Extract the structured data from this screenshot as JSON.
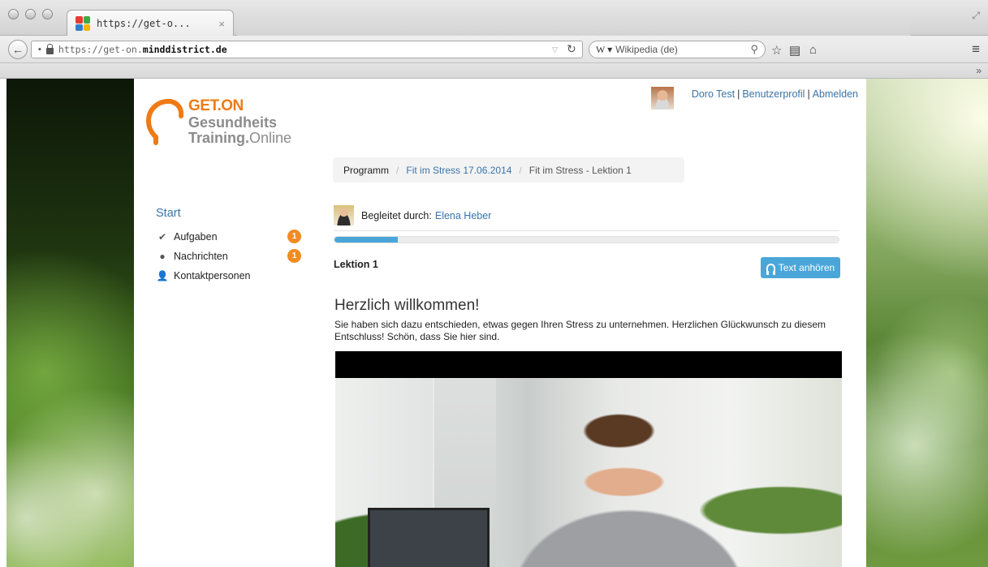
{
  "browser": {
    "tab_title": "https://get-o...",
    "tab_close": "×",
    "url_scheme": "https://get-on.",
    "url_domain": "minddistrict.de",
    "search_engine": "W ▾",
    "search_placeholder": "Wikipedia (de)",
    "favicon_colors": [
      "#e63b2e",
      "#3ea84a",
      "#2f7fd0",
      "#f4b400"
    ]
  },
  "logo": {
    "line1": "GET.ON",
    "line2": "Gesundheits",
    "line3_bold": "Training.",
    "line3_light": "Online",
    "colors": {
      "orange": "#f07a14",
      "gray": "#8c8c8c"
    }
  },
  "user": {
    "name": "Doro Test",
    "profile": "Benutzerprofil",
    "logout": "Abmelden",
    "separator": "|"
  },
  "breadcrumb": {
    "items": [
      "Programm",
      "Fit im Stress 17.06.2014",
      "Fit im Stress - Lektion 1"
    ],
    "separator": "/"
  },
  "sidenav": {
    "title": "Start",
    "items": [
      {
        "label": "Aufgaben",
        "icon": "check-icon",
        "badge": "1"
      },
      {
        "label": "Nachrichten",
        "icon": "chat-icon",
        "badge": "1"
      },
      {
        "label": "Kontaktpersonen",
        "icon": "person-icon",
        "badge": ""
      }
    ]
  },
  "guide": {
    "label": "Begleitet durch:",
    "name": "Elena Heber"
  },
  "progress": {
    "fraction": 0.125
  },
  "lesson": {
    "title": "Lektion 1",
    "listen_label": "Text anhören"
  },
  "welcome": {
    "heading": "Herzlich willkommen!",
    "text": "Sie haben sich dazu entschieden, etwas gegen Ihren Stress zu unternehmen. Herzlichen Glückwunsch zu diesem Entschluss! Schön, dass Sie hier sind."
  },
  "colors": {
    "link": "#3a74a8",
    "accent_blue": "#4aa6d8",
    "badge_orange": "#f08c21"
  }
}
